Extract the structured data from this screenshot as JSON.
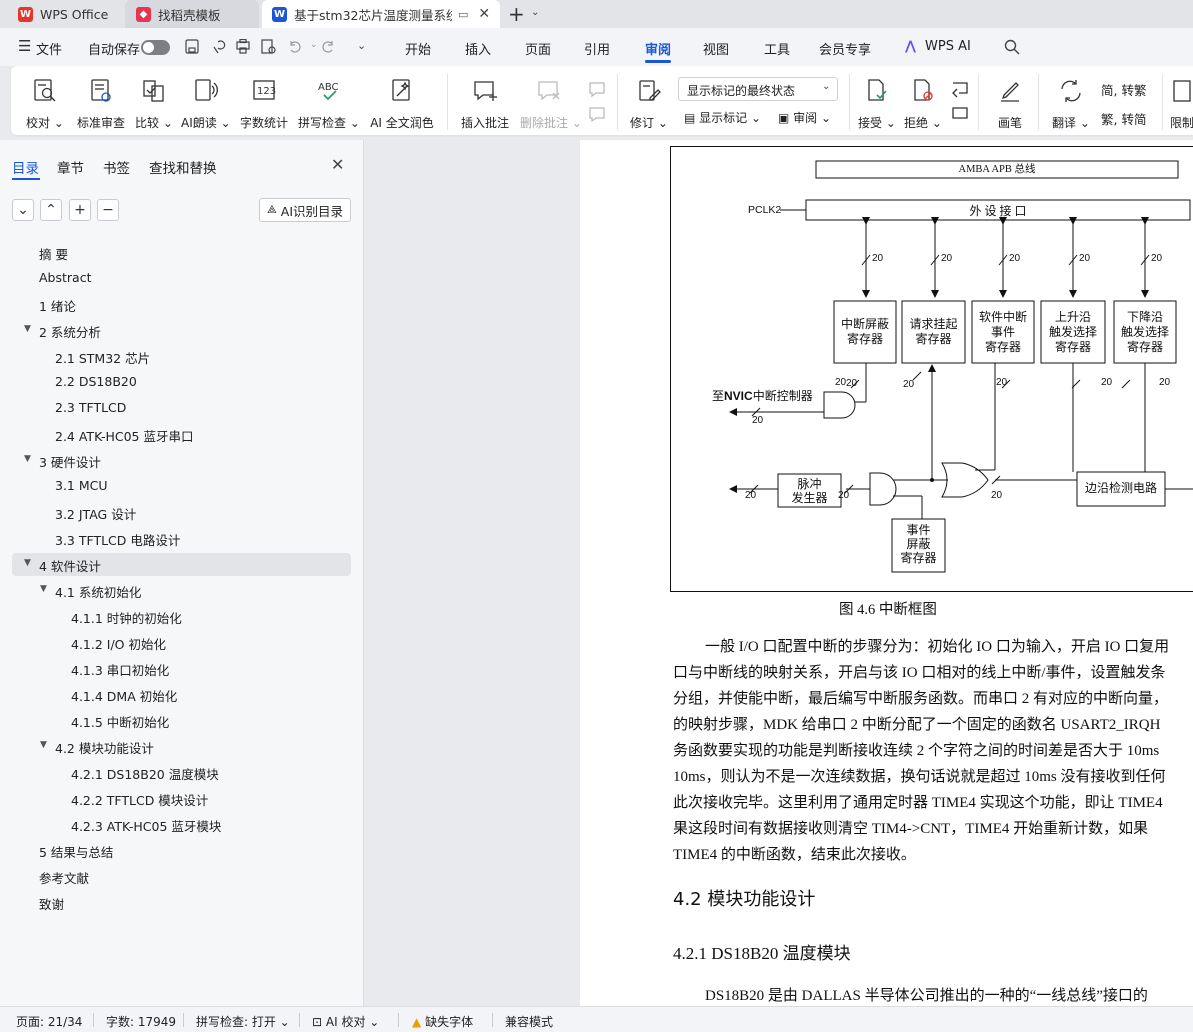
{
  "tabs": [
    {
      "label": "WPS Office"
    },
    {
      "label": "找稻壳模板"
    },
    {
      "label": "基于stm32芯片温度测量系统"
    }
  ],
  "menu": {
    "file": "文件",
    "autosave": "自动保存",
    "items": [
      "开始",
      "插入",
      "页面",
      "引用",
      "审阅",
      "视图",
      "工具",
      "会员专享"
    ],
    "active": "审阅",
    "wps_ai": "WPS AI"
  },
  "ribbon": {
    "proofread": "校对",
    "standard_review": "标准审查",
    "compare": "比较",
    "ai_read": "AI朗读",
    "word_count": "字数统计",
    "spell_check": "拼写检查",
    "ai_polish": "AI 全文润色",
    "insert_comment": "插入批注",
    "delete_comment": "删除批注",
    "revise": "修订",
    "markup_select": "显示标记的最终状态",
    "show_markup": "显示标记",
    "review": "审阅",
    "accept": "接受",
    "reject": "拒绝",
    "pen": "画笔",
    "translate": "翻译",
    "to_traditional": "转繁",
    "to_simplified": "转简",
    "restrict": "限制"
  },
  "leftpanel": {
    "tabs": [
      "目录",
      "章节",
      "书签",
      "查找和替换"
    ],
    "ai_toc": "AI识别目录",
    "toc": [
      {
        "label": "摘    要",
        "level": 1
      },
      {
        "label": "Abstract",
        "level": 1
      },
      {
        "label": "1  绪论",
        "level": 1
      },
      {
        "label": "2  系统分析",
        "level": 1,
        "expanded": true
      },
      {
        "label": "2.1 STM32 芯片",
        "level": 2
      },
      {
        "label": "2.2 DS18B20",
        "level": 2
      },
      {
        "label": "2.3 TFTLCD",
        "level": 2
      },
      {
        "label": "2.4 ATK-HC05 蓝牙串口",
        "level": 2
      },
      {
        "label": "3  硬件设计",
        "level": 1,
        "expanded": true
      },
      {
        "label": "3.1 MCU",
        "level": 2
      },
      {
        "label": "3.2 JTAG 设计",
        "level": 2
      },
      {
        "label": "3.3 TFTLCD 电路设计",
        "level": 2
      },
      {
        "label": "4  软件设计",
        "level": 1,
        "expanded": true,
        "selected": true
      },
      {
        "label": "4.1  系统初始化",
        "level": 2,
        "expanded": true
      },
      {
        "label": "4.1.1  时钟的初始化",
        "level": 3
      },
      {
        "label": "4.1.2 I/O 初始化",
        "level": 3
      },
      {
        "label": "4.1.3  串口初始化",
        "level": 3
      },
      {
        "label": "4.1.4 DMA 初始化",
        "level": 3
      },
      {
        "label": "4.1.5  中断初始化",
        "level": 3
      },
      {
        "label": "4.2  模块功能设计",
        "level": 2,
        "expanded": true
      },
      {
        "label": "4.2.1 DS18B20 温度模块",
        "level": 3
      },
      {
        "label": "4.2.2 TFTLCD 模块设计",
        "level": 3
      },
      {
        "label": "4.2.3 ATK-HC05 蓝牙模块",
        "level": 3
      },
      {
        "label": "5 结果与总结",
        "level": 1
      },
      {
        "label": "参考文献",
        "level": 1
      },
      {
        "label": "致谢",
        "level": 1
      }
    ]
  },
  "document": {
    "diagram": {
      "bus": "AMBA APB 总线",
      "pclk": "PCLK2",
      "interface": "外 设 接 口",
      "widths": [
        "20",
        "20",
        "20",
        "20",
        "20"
      ],
      "registers": [
        [
          "中断屏蔽",
          "寄存器"
        ],
        [
          "请求挂起",
          "寄存器"
        ],
        [
          "软件中断",
          "事件",
          "寄存器"
        ],
        [
          "上升沿",
          "触发选择",
          "寄存器"
        ],
        [
          "下降沿",
          "触发选择",
          "寄存器"
        ]
      ],
      "nvic_prefix": "至",
      "nvic_bold": "NVIC",
      "nvic_suffix": "中断控制器",
      "pulse": [
        "脉冲",
        "发生器"
      ],
      "edge": "边沿检测电路",
      "event_mask": [
        "事件",
        "屏蔽",
        "寄存器"
      ],
      "bus_width": "20"
    },
    "figure_caption": "图 4.6  中断框图",
    "paragraph_lines": [
      "一般 I/O 口配置中断的步骤分为：初始化 IO 口为输入，开启 IO 口复用",
      "口与中断线的映射关系，开启与该 IO 口相对的线上中断/事件，设置触发条",
      "分组，并使能中断，最后编写中断服务函数。而串口 2 有对应的中断向量，",
      "的映射步骤，MDK 给串口 2 中断分配了一个固定的函数名 USART2_IRQH",
      "务函数要实现的功能是判断接收连续 2 个字符之间的时间差是否大于 10ms",
      "10ms，则认为不是一次连续数据，换句话说就是超过 10ms 没有接收到任何",
      "此次接收完毕。这里利用了通用定时器 TIME4 实现这个功能，即让 TIME4",
      "果这段时间有数据接收则清空 TIM4->CNT，TIME4 开始重新计数，如果",
      "TIME4 的中断函数，结束此次接收。"
    ],
    "heading_42": "4.2  模块功能设计",
    "heading_421": "4.2.1 DS18B20 温度模块",
    "last_line": "DS18B20 是由 DALLAS 半导体公司推出的一种的“一线总线”接口的"
  },
  "statusbar": {
    "page": "页面: 21/34",
    "words": "字数: 17949",
    "spell": "拼写检查: 打开",
    "ai_proof": "AI 校对",
    "missing_font": "缺失字体",
    "compat": "兼容模式"
  },
  "colors": {
    "accent": "#1a57d6",
    "wps_red": "#e8352b"
  }
}
